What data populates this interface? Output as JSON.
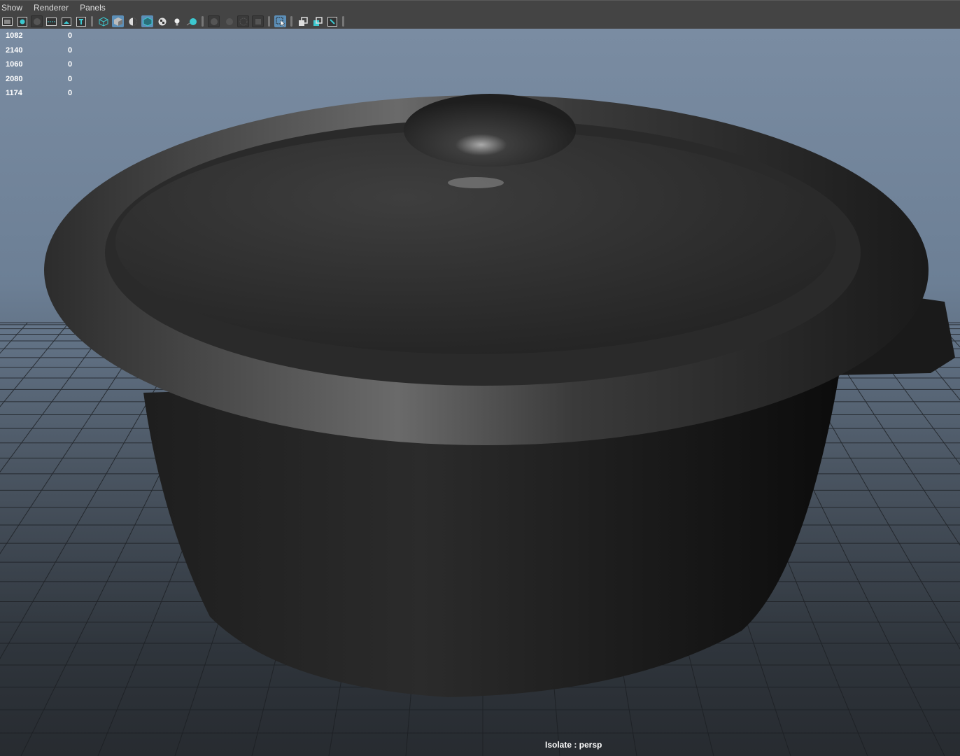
{
  "menu": [
    "Show",
    "Renderer",
    "Panels"
  ],
  "toolbar_icons": [
    "camera-film-icon",
    "select-camera-icon",
    "lock-camera-icon",
    "film-gate-icon",
    "image-plane-icon",
    "2d-pan-zoom-icon",
    "wireframe-icon",
    "smooth-shade-icon",
    "shade-selected-icon",
    "wireframe-on-shaded-icon",
    "textured-icon",
    "use-lights-icon",
    "shadows-icon",
    "screen-space-ao-icon",
    "motion-blur-icon",
    "anti-aliasing-icon",
    "depth-of-field-icon",
    "isolate-select-icon",
    "xray-icon",
    "xray-joints-icon",
    "xray-active-icon"
  ],
  "hud": [
    [
      "1082",
      "0"
    ],
    [
      "2140",
      "0"
    ],
    [
      "1060",
      "0"
    ],
    [
      "2080",
      "0"
    ],
    [
      "1174",
      "0"
    ]
  ],
  "isolate_label": "Isolate : persp",
  "colors": {
    "menubar": "#444444",
    "toggle_on": "#5c8fb8",
    "accent_cyan": "#3cc8d0"
  }
}
